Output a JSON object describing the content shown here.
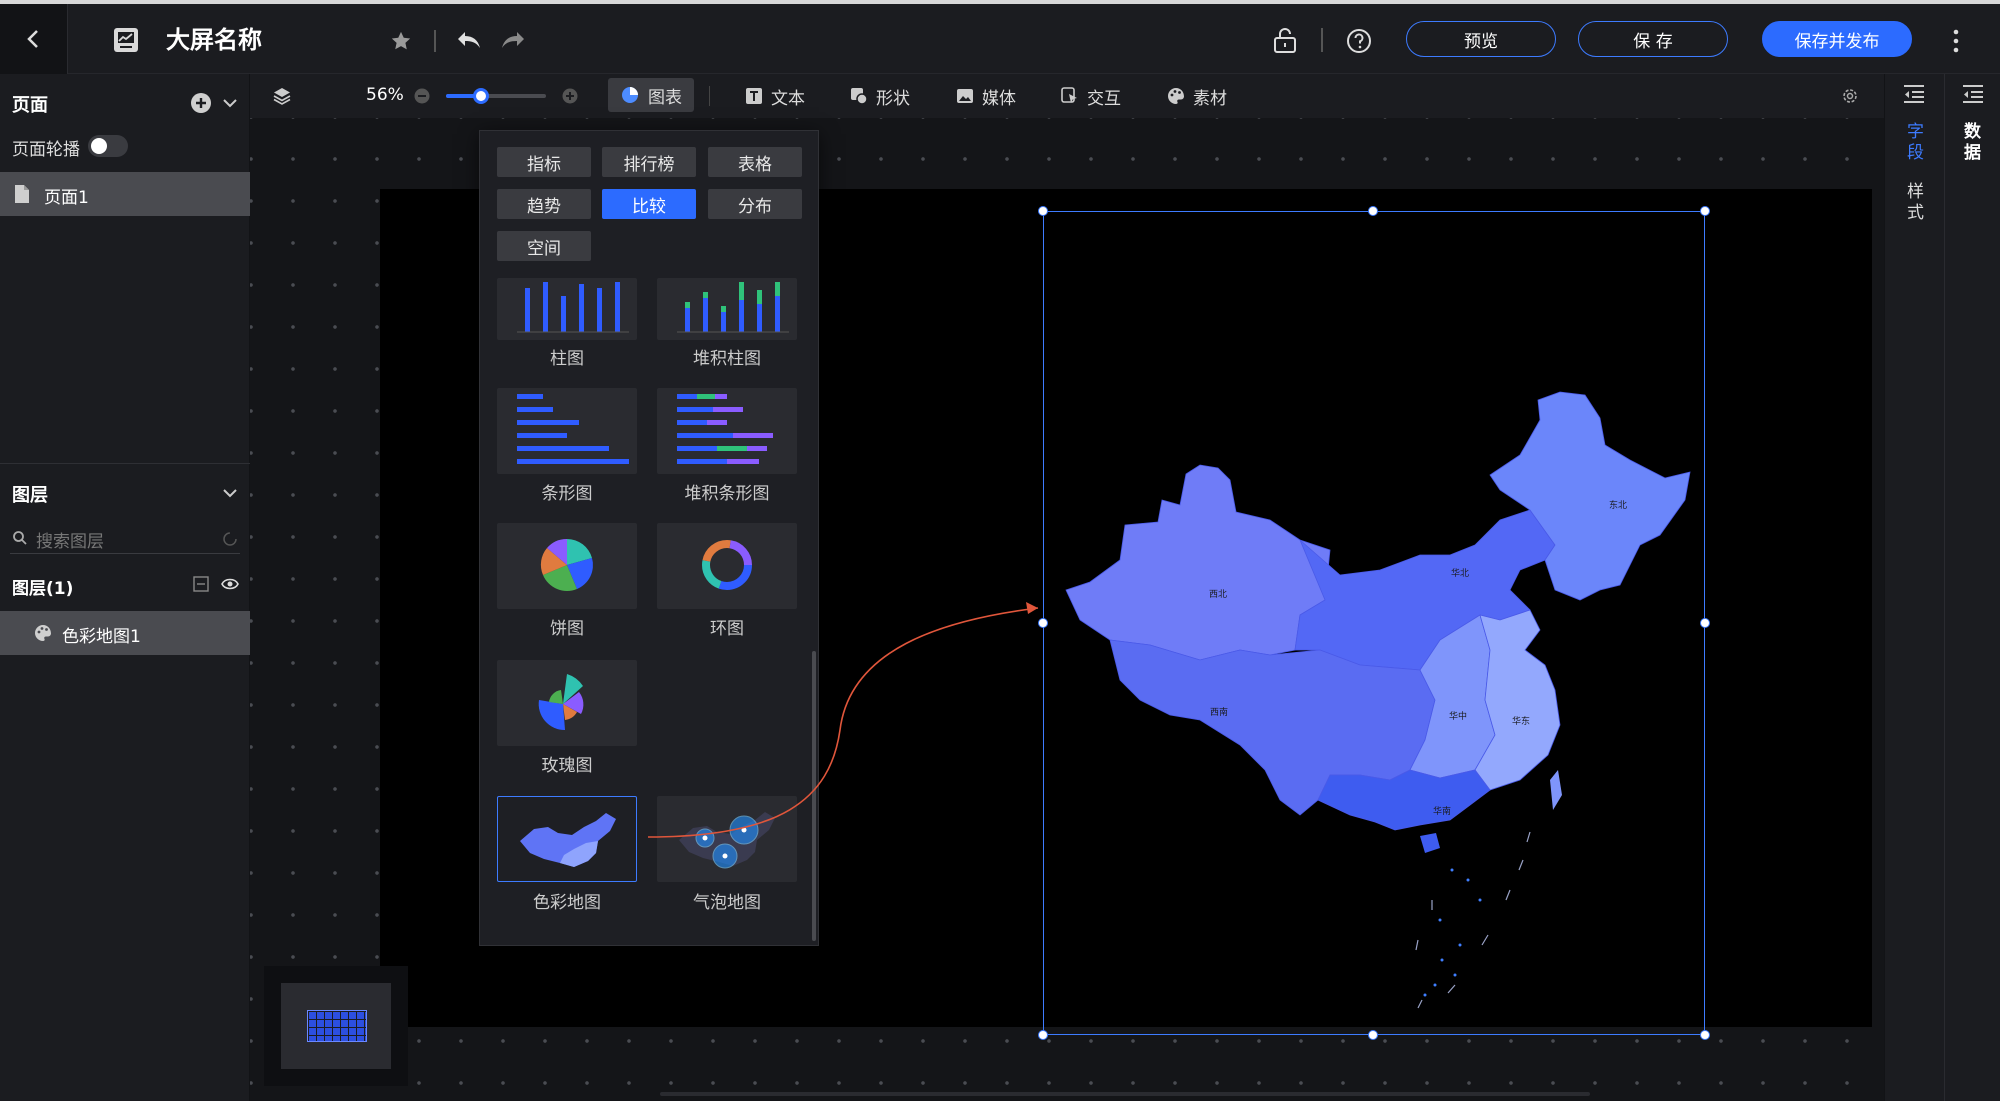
{
  "header": {
    "title": "大屏名称",
    "preview_label": "预览",
    "save_label": "保 存",
    "publish_label": "保存并发布"
  },
  "toolbar": {
    "zoom": "56%",
    "zoom_value": 0.35,
    "items": [
      {
        "label": "图表",
        "icon": "pie-chart-icon",
        "active": true
      },
      {
        "label": "文本",
        "icon": "text-icon"
      },
      {
        "label": "形状",
        "icon": "shape-icon"
      },
      {
        "label": "媒体",
        "icon": "image-icon"
      },
      {
        "label": "交互",
        "icon": "interaction-icon"
      },
      {
        "label": "素材",
        "icon": "palette-icon"
      }
    ]
  },
  "left_panel": {
    "pages_title": "页面",
    "carousel_label": "页面轮播",
    "carousel_on": false,
    "page_item": "页面1",
    "layers_title": "图层",
    "search_placeholder": "搜索图层",
    "layers_count_label": "图层(1)",
    "layer_item": "色彩地图1"
  },
  "chart_popup": {
    "categories": [
      "指标",
      "排行榜",
      "表格",
      "趋势",
      "比较",
      "分布",
      "空间"
    ],
    "active_category": "比较",
    "charts": [
      "柱图",
      "堆积柱图",
      "条形图",
      "堆积条形图",
      "饼图",
      "环图",
      "玫瑰图",
      "色彩地图",
      "气泡地图"
    ],
    "selected_chart": "色彩地图"
  },
  "right_panel": {
    "tab1_a": "字",
    "tab1_b": "段",
    "tab2_a": "样",
    "tab2_b": "式",
    "tab3_a": "数",
    "tab3_b": "据"
  },
  "map": {
    "regions": [
      "西北",
      "华北",
      "东北",
      "西南",
      "华中",
      "华东",
      "华南"
    ],
    "colors": {
      "xibei": "#6f7cf7",
      "huabei": "#5368f5",
      "dongbei": "#6b86fa",
      "xinan": "#5a6cf2",
      "huazhong": "#7f95fb",
      "huadong": "#93a8fd",
      "huanan": "#3e5cf0"
    }
  },
  "colors": {
    "accent": "#2c6bff",
    "arrow": "#e0563b"
  }
}
